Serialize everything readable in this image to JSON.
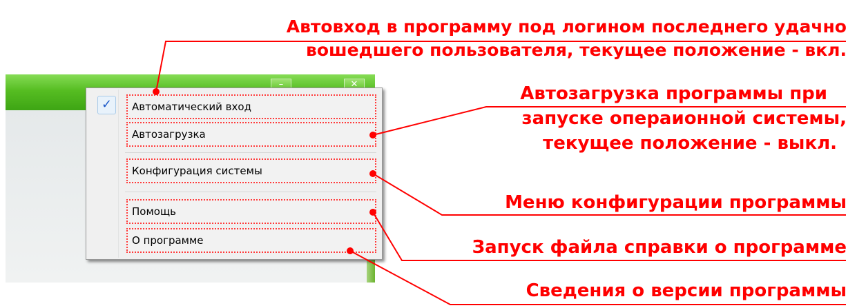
{
  "menu": {
    "items": [
      {
        "label": "Автоматический вход",
        "checked": true
      },
      {
        "label": "Автозагрузка",
        "checked": false
      },
      {
        "label": "Конфигурация системы",
        "checked": false
      },
      {
        "label": "Помощь",
        "checked": false
      },
      {
        "label": "О программе",
        "checked": false
      }
    ],
    "check_mark": "✓"
  },
  "window": {
    "minimize_glyph": "–",
    "close_glyph": "✕"
  },
  "callouts": {
    "autologin_line1": "Автовход в программу под логином последнего удачно",
    "autologin_line2": "вошедшего пользователя, текущее положение - вкл.",
    "autostart_line1": "Автозагрузка программы при",
    "autostart_line2": "запуске операионной системы,",
    "autostart_line3": "текущее положение - выкл.",
    "config": "Меню конфигурации программы",
    "help": "Запуск файла справки о программе",
    "about": "Сведения о версии программы"
  },
  "colors": {
    "annotation": "#ff0000",
    "titlebar": "#56bd22",
    "menu_bg": "#f0f0f0"
  }
}
